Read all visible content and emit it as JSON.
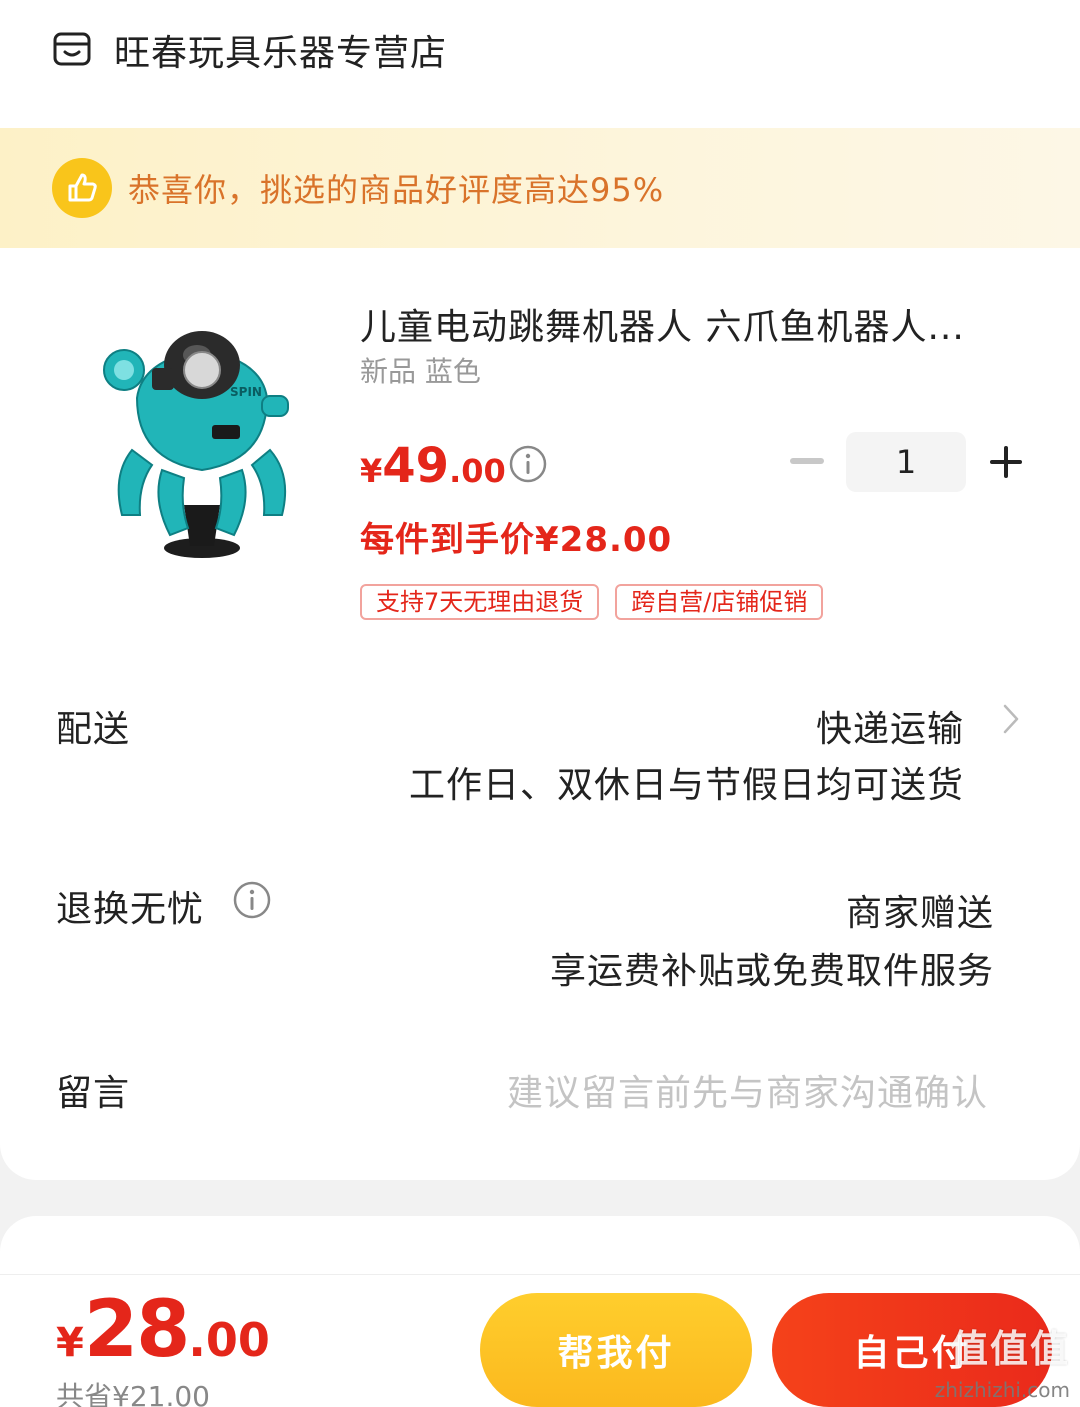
{
  "store": {
    "name": "旺春玩具乐器专营店",
    "icon": "store-icon"
  },
  "banner": {
    "text": "恭喜你，挑选的商品好评度高达95%",
    "icon": "thumbs-up-icon"
  },
  "product": {
    "title": "儿童电动跳舞机器人 六爪鱼机器人...",
    "sku": "新品 蓝色",
    "price_symbol": "¥",
    "price_int": "49",
    "price_dec": ".00",
    "quantity": "1",
    "net_price": "每件到手价¥28.00",
    "tags": [
      "支持7天无理由退货",
      "跨自营/店铺促销"
    ]
  },
  "delivery": {
    "label": "配送",
    "method": "快递运输",
    "note": "工作日、双休日与节假日均可送货"
  },
  "returns": {
    "label": "退换无忧",
    "value": "商家赠送",
    "note": "享运费补贴或免费取件服务"
  },
  "remark": {
    "label": "留言",
    "placeholder": "建议留言前先与商家沟通确认"
  },
  "footer": {
    "total_symbol": "¥",
    "total_int": "28",
    "total_dec": ".00",
    "saved": "共省¥21.00",
    "help_pay_label": "帮我付",
    "self_pay_label": "自己付"
  },
  "watermark": {
    "text": "值值值",
    "sub": "zhizhizhi.com"
  },
  "colors": {
    "accent_red": "#e4261a",
    "banner_text": "#d9732a",
    "help_btn": "#fbb81e",
    "pay_btn": "#ea2a1b"
  }
}
